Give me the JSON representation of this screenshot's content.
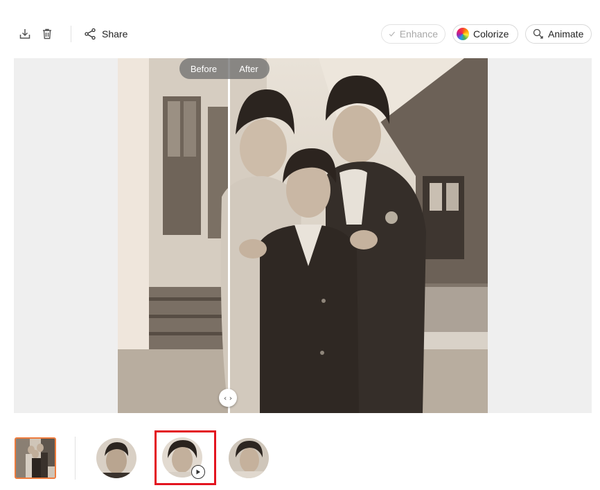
{
  "toolbar": {
    "download_icon": "download-icon",
    "delete_icon": "trash-icon",
    "share_label": "Share",
    "enhance_label": "Enhance",
    "colorize_label": "Colorize",
    "animate_label": "Animate"
  },
  "viewer": {
    "before_label": "Before",
    "after_label": "After",
    "handle_glyph": "‹ ›"
  },
  "thumbnails": {
    "items": [
      "photo-thumbnail",
      "face-thumbnail-1",
      "face-thumbnail-2-animated",
      "face-thumbnail-3"
    ]
  },
  "colors": {
    "accent_orange": "#ee7b3c",
    "highlight_red": "#e3141f",
    "viewer_bg": "#efefef"
  }
}
